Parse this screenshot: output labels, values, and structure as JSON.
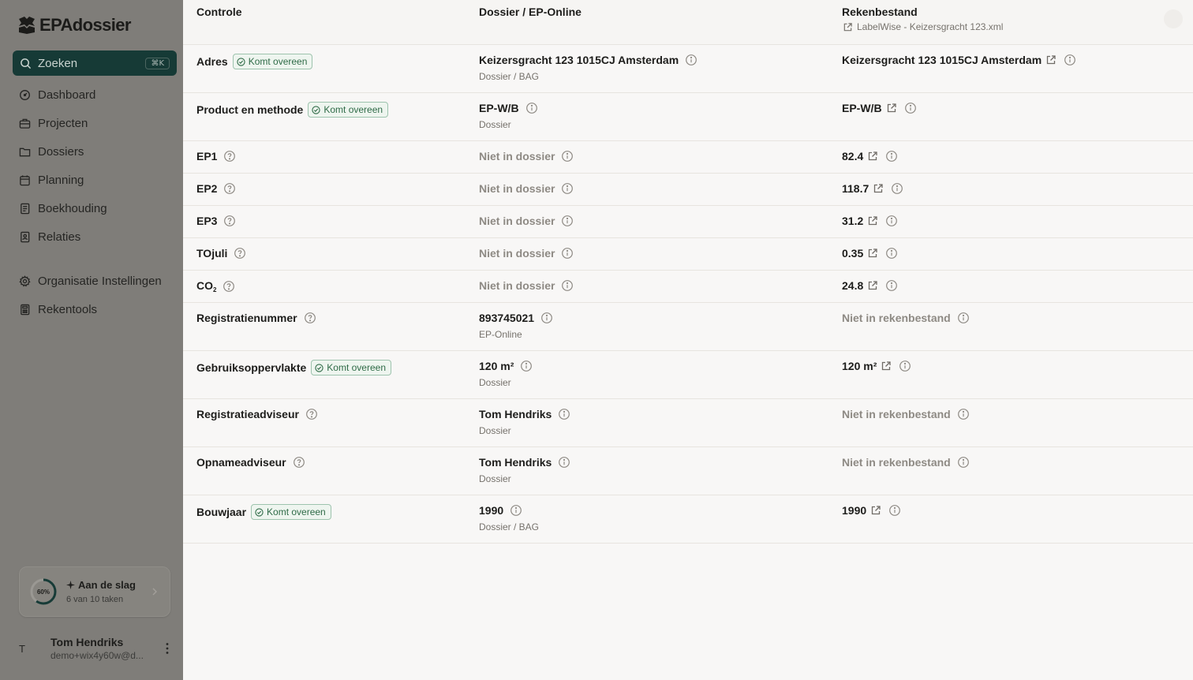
{
  "brand": {
    "name": "EPAdossier"
  },
  "search": {
    "label": "Zoeken",
    "shortcut": "⌘K"
  },
  "nav": {
    "items": [
      {
        "label": "Dashboard",
        "icon": "gauge-icon"
      },
      {
        "label": "Projecten",
        "icon": "briefcase-icon"
      },
      {
        "label": "Dossiers",
        "icon": "folder-icon"
      },
      {
        "label": "Planning",
        "icon": "calendar-icon"
      },
      {
        "label": "Boekhouding",
        "icon": "ledger-icon"
      },
      {
        "label": "Relaties",
        "icon": "contacts-icon"
      }
    ],
    "secondary": [
      {
        "label": "Organisatie Instellingen",
        "icon": "gear-icon"
      },
      {
        "label": "Rekentools",
        "icon": "calculator-icon"
      }
    ]
  },
  "onboarding": {
    "progress_label": "60%",
    "progress": 0.6,
    "title": "Aan de slag",
    "subtitle": "6 van 10 taken"
  },
  "user": {
    "initial": "T",
    "name": "Tom Hendriks",
    "email": "demo+wix4y60w@d..."
  },
  "table": {
    "headers": {
      "check": "Controle",
      "dossier": "Dossier / EP-Online",
      "file": "Rekenbestand"
    },
    "file_name": "LabelWise - Keizersgracht 123.xml",
    "match_label": "Komt overeen",
    "rows": [
      {
        "label": "Adres",
        "match": true,
        "dossier_value": "Keizersgracht 123 1015CJ Amsterdam",
        "dossier_source": "Dossier / BAG",
        "file_value": "Keizersgracht 123 1015CJ Amsterdam"
      },
      {
        "label": "Product en methode",
        "match": true,
        "dossier_value": "EP-W/B",
        "dossier_source": "Dossier",
        "file_value": "EP-W/B"
      },
      {
        "label": "EP1",
        "help": true,
        "dossier_value": "Niet in dossier",
        "file_value": "82.4"
      },
      {
        "label": "EP2",
        "help": true,
        "dossier_value": "Niet in dossier",
        "file_value": "118.7"
      },
      {
        "label": "EP3",
        "help": true,
        "dossier_value": "Niet in dossier",
        "file_value": "31.2"
      },
      {
        "label": "TOjuli",
        "help": true,
        "dossier_value": "Niet in dossier",
        "file_value": "0.35"
      },
      {
        "label": "CO",
        "label_sub": "2",
        "help": true,
        "dossier_value": "Niet in dossier",
        "file_value": "24.8"
      },
      {
        "label": "Registratienummer",
        "help": true,
        "dossier_value": "893745021",
        "dossier_source": "EP-Online",
        "file_value": "Niet in rekenbestand"
      },
      {
        "label": "Gebruiksoppervlakte",
        "match": true,
        "dossier_value": "120 m²",
        "dossier_source": "Dossier",
        "file_value": "120 m²"
      },
      {
        "label": "Registratieadviseur",
        "help": true,
        "dossier_value": "Tom Hendriks",
        "dossier_source": "Dossier",
        "file_value": "Niet in rekenbestand"
      },
      {
        "label": "Opnameadviseur",
        "help": true,
        "dossier_value": "Tom Hendriks",
        "dossier_source": "Dossier",
        "file_value": "Niet in rekenbestand"
      },
      {
        "label": "Bouwjaar",
        "match": true,
        "dossier_value": "1990",
        "dossier_source": "Dossier / BAG",
        "file_value": "1990"
      }
    ]
  }
}
